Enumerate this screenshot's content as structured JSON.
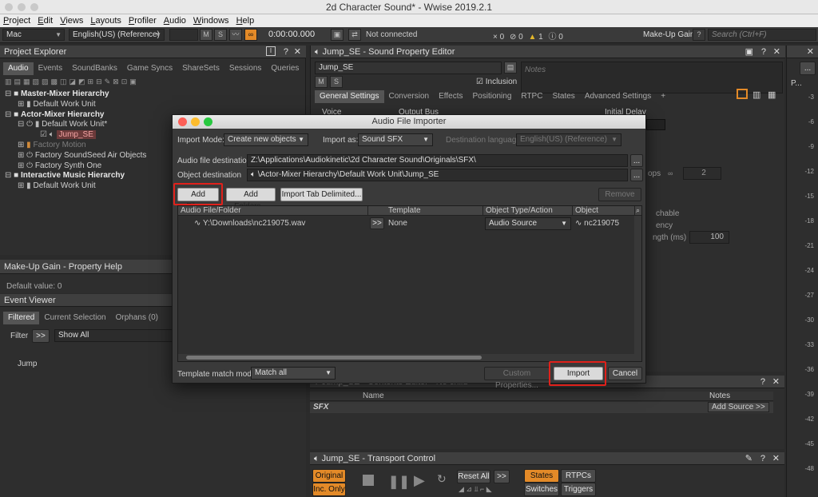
{
  "window": {
    "title": "2d Character Sound* - Wwise 2019.2.1"
  },
  "menu": [
    "Project",
    "Edit",
    "Views",
    "Layouts",
    "Profiler",
    "Audio",
    "Windows",
    "Help"
  ],
  "toolbar": {
    "platform": "Mac",
    "language": "English(US) (Reference)",
    "m": "M",
    "s": "S",
    "time": "0:00:00.000",
    "connection": "Not connected",
    "counts": [
      "0",
      "0",
      "1",
      "0"
    ],
    "makeup_gain": "Make-Up Gain",
    "help": "?",
    "search_placeholder": "Search (Ctrl+F)"
  },
  "project_explorer": {
    "title": "Project Explorer",
    "tabs": [
      "Audio",
      "Events",
      "SoundBanks",
      "Game Syncs",
      "ShareSets",
      "Sessions",
      "Queries"
    ],
    "tree": [
      {
        "label": "Master-Mixer Hierarchy",
        "style": "bold"
      },
      {
        "label": "Default Work Unit",
        "style": "normal"
      },
      {
        "label": "Actor-Mixer Hierarchy",
        "style": "bold"
      },
      {
        "label": "Default Work Unit*",
        "style": "normal"
      },
      {
        "label": "Jump_SE",
        "style": "selected"
      },
      {
        "label": "Factory Motion",
        "style": "dim"
      },
      {
        "label": "Factory SoundSeed Air Objects",
        "style": "normal"
      },
      {
        "label": "Factory Synth One",
        "style": "normal"
      },
      {
        "label": "Interactive Music Hierarchy",
        "style": "bold"
      },
      {
        "label": "Default Work Unit",
        "style": "normal"
      }
    ]
  },
  "property_help": {
    "title": "Make-Up Gain - Property Help",
    "text": "Default value: 0"
  },
  "event_viewer": {
    "title": "Event Viewer",
    "tabs": [
      "Filtered",
      "Current Selection",
      "Orphans (0)"
    ],
    "filter_label": "Filter",
    "filter_btn": ">>",
    "filter_value": "Show All",
    "items": [
      "Jump"
    ]
  },
  "sound_editor": {
    "title": "Jump_SE - Sound Property Editor",
    "name": "Jump_SE",
    "notes_placeholder": "Notes",
    "inclusion": "Inclusion",
    "tabs": [
      "General Settings",
      "Conversion",
      "Effects",
      "Positioning",
      "RTPC",
      "States",
      "Advanced Settings",
      "+"
    ],
    "voice": "Voice",
    "output_bus": "Output Bus",
    "initial_delay": "Initial Delay",
    "loops_label": "ops",
    "loops_value": "2",
    "cachable": "chable",
    "latency": "ency",
    "length_label": "ngth (ms)",
    "length_value": "100"
  },
  "contents_editor": {
    "title": "Jump_SE - Contents Editor - No child",
    "col_name": "Name",
    "col_notes": "Notes",
    "row": "SFX",
    "add_source": "Add Source >>"
  },
  "transport": {
    "title": "Jump_SE - Transport Control",
    "original": "Original",
    "inc_only": "Inc. Only",
    "reset_all": "Reset All",
    "reset_arrow": ">>",
    "states": "States",
    "rtpcs": "RTPCs",
    "switches": "Switches",
    "triggers": "Triggers"
  },
  "meter": {
    "label": "P...",
    "ticks": [
      "-3",
      "-6",
      "-9",
      "-12",
      "-15",
      "-18",
      "-21",
      "-24",
      "-27",
      "-30",
      "-33",
      "-36",
      "-39",
      "-42",
      "-45",
      "-48"
    ]
  },
  "dialog": {
    "title": "Audio File Importer",
    "import_mode_label": "Import Mode:",
    "import_mode_value": "Create new objects",
    "import_as_label": "Import as:",
    "import_as_value": "Sound SFX",
    "dest_lang_label": "Destination language:",
    "dest_lang_value": "English(US) (Reference)",
    "audio_dest_label": "Audio file destination",
    "audio_dest_value": "Z:\\Applications\\Audiokinetic\\2d Character Sound\\Originals\\SFX\\",
    "obj_dest_label": "Object destination",
    "obj_dest_value": "\\Actor-Mixer Hierarchy\\Default Work Unit\\Jump_SE",
    "browse": "...",
    "add_files": "Add Files...",
    "add_folders": "Add Folders...",
    "import_tab": "Import Tab Delimited...",
    "remove": "Remove",
    "columns": [
      "Audio File/Folder",
      "Template",
      "Object Type/Action",
      "Object"
    ],
    "rows": [
      {
        "file": "Y:\\Downloads\\nc219075.wav",
        "arrow": ">>",
        "template": "None",
        "type": "Audio Source",
        "object": "nc219075"
      }
    ],
    "template_match_label": "Template match mode:",
    "template_match_value": "Match all",
    "custom_props": "Custom Properties...",
    "import": "Import",
    "cancel": "Cancel"
  },
  "colors": {
    "accent_orange": "#e38a28",
    "highlight_red": "#e0211b",
    "dialog_bg": "#3a3a3a"
  }
}
